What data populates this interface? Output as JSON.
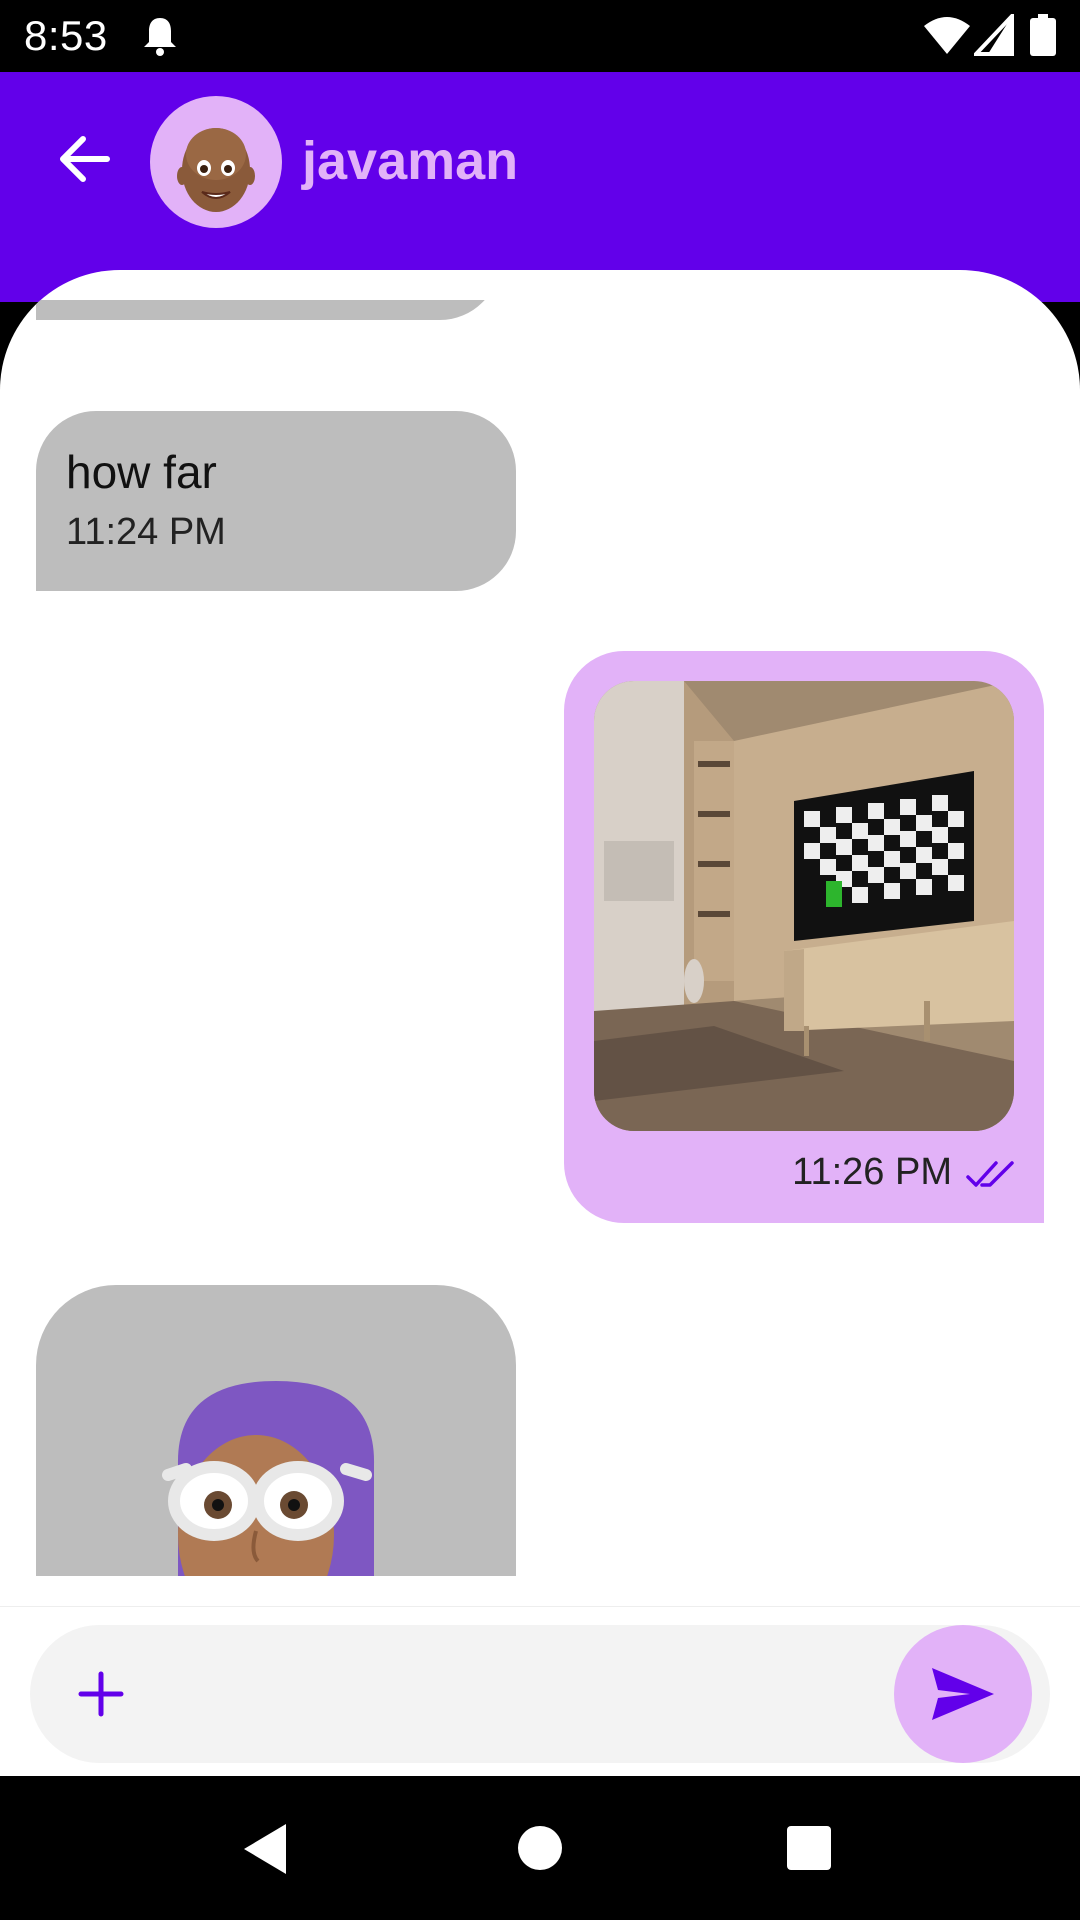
{
  "status_bar": {
    "time": "8:53",
    "icons": [
      "notification-bell-icon",
      "wifi-icon",
      "signal-icon",
      "battery-icon"
    ]
  },
  "header": {
    "back_icon": "arrow-left-icon",
    "contact_name": "javaman",
    "avatar": "memoji-avatar"
  },
  "messages": [
    {
      "direction": "incoming",
      "type": "text",
      "text": "how far",
      "time": "11:24 PM"
    },
    {
      "direction": "outgoing",
      "type": "image",
      "image": "living-room-photo",
      "time": "11:26 PM",
      "status_icon": "double-check-icon"
    },
    {
      "direction": "incoming",
      "type": "sticker",
      "image": "memoji-sticker"
    }
  ],
  "composer": {
    "attach_icon": "plus-icon",
    "placeholder": "",
    "send_icon": "send-icon"
  },
  "nav_bar": {
    "icons": [
      "nav-back-icon",
      "nav-home-icon",
      "nav-recents-icon"
    ]
  },
  "colors": {
    "primary": "#6200ea",
    "accent": "#e2b2f8",
    "incoming_bubble": "#bdbdbd",
    "background": "#ffffff"
  }
}
